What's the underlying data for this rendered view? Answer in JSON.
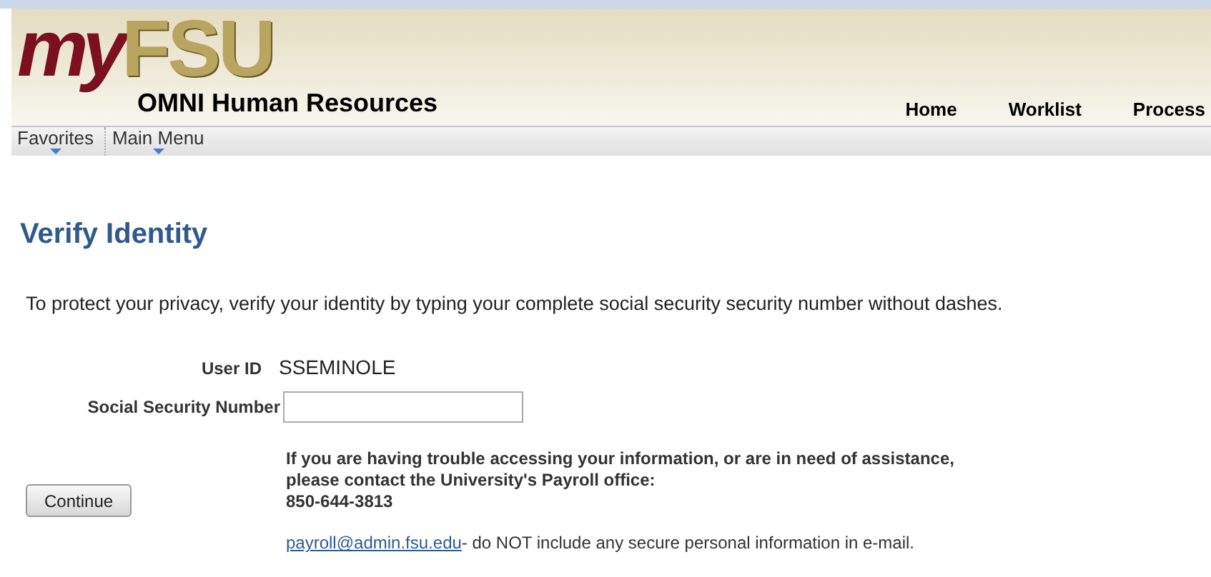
{
  "header": {
    "logo_left": "my",
    "logo_right": "FSU",
    "subtitle": "OMNI Human Resources",
    "nav": [
      "Home",
      "Worklist",
      "Process"
    ]
  },
  "menu": [
    "Favorites",
    "Main Menu"
  ],
  "page_title": "Verify Identity",
  "instructions": "To protect your privacy, verify your identity by typing your complete social security security number without dashes.",
  "user_id": {
    "label": "User ID",
    "value": "SSEMINOLE"
  },
  "ssn": {
    "label": "Social Security Number"
  },
  "continue_button": "Continue",
  "help": {
    "lines": [
      "If you are having trouble accessing your information, or are in need of assistance,",
      "please contact the University's Payroll office:",
      "850-644-3813"
    ],
    "email": "payroll@admin.fsu.edu",
    "email_note": "- do NOT include any secure personal information in e-mail."
  }
}
